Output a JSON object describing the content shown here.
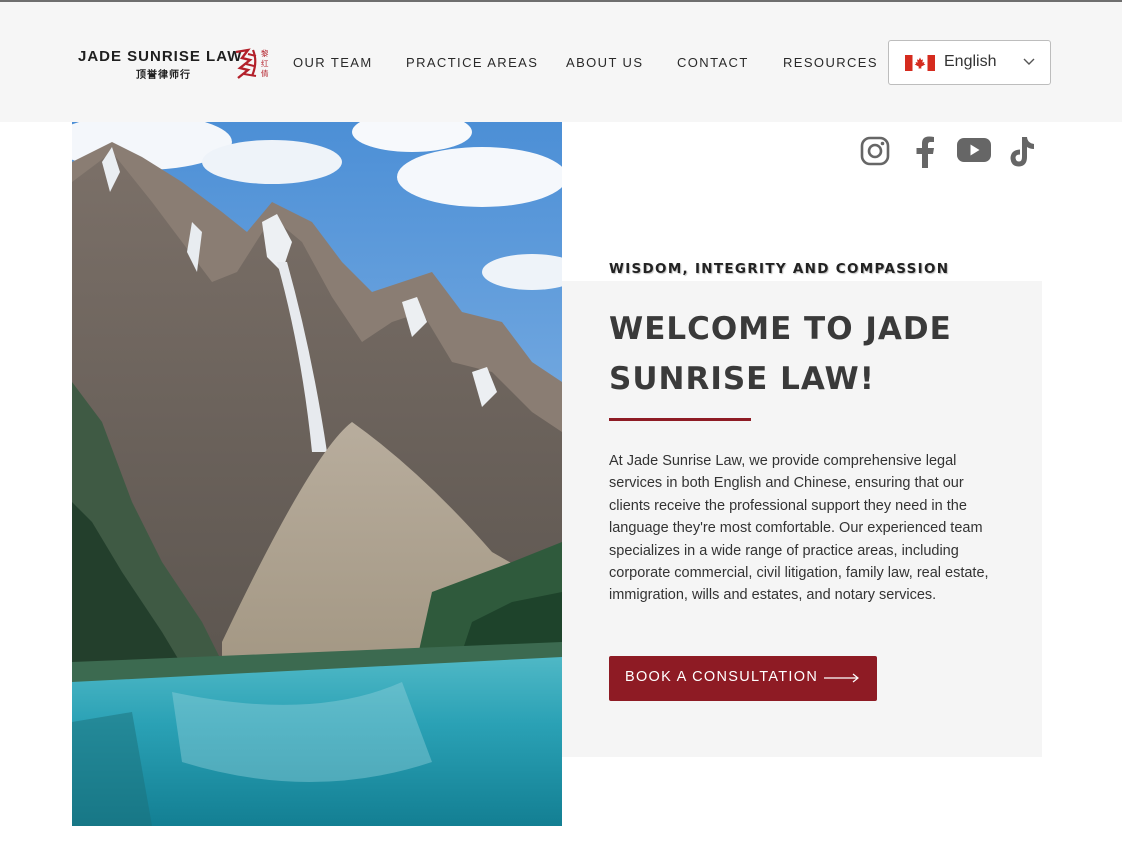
{
  "brand": {
    "name": "JADE SUNRISE LAW",
    "subtitle": "顶誉律师行",
    "seal_text": "黎红倩"
  },
  "nav": {
    "items": [
      {
        "label": "OUR TEAM"
      },
      {
        "label": "PRACTICE AREAS"
      },
      {
        "label": "ABOUT US"
      },
      {
        "label": "CONTACT"
      },
      {
        "label": "RESOURCES"
      }
    ]
  },
  "language": {
    "selected": "English",
    "flag_icon": "canada-flag-icon"
  },
  "social": {
    "icons": [
      "instagram-icon",
      "facebook-icon",
      "youtube-icon",
      "tiktok-icon"
    ],
    "color": "#666666"
  },
  "hero": {
    "tagline": "WISDOM, INTEGRITY AND COMPASSION",
    "title": "WELCOME TO JADE SUNRISE LAW!",
    "body": "At Jade Sunrise Law, we provide comprehensive legal services in both English and Chinese, ensuring that our clients receive the professional support they need in the language they're most comfortable.  Our experienced team specializes in a wide range of practice areas, including corporate commercial, civil litigation, family law, real estate, immigration, wills and estates, and notary services.",
    "cta_label": "BOOK A CONSULTATION"
  },
  "colors": {
    "accent": "#8e1b24",
    "header_bg": "#f6f6f6",
    "card_bg": "#f5f5f5"
  }
}
